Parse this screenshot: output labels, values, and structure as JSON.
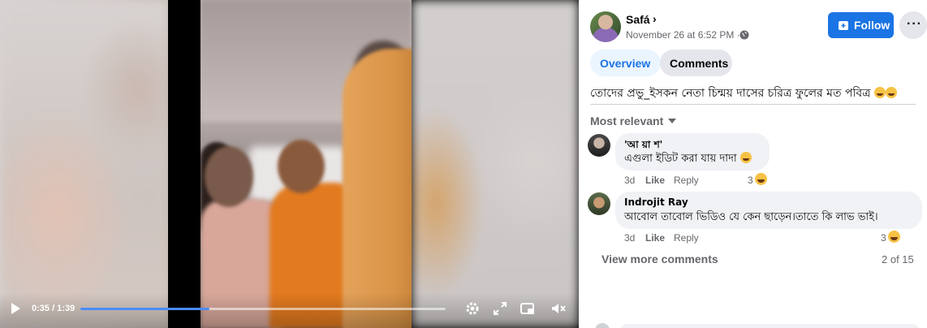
{
  "video": {
    "time_display": "0:35 / 1:39",
    "progress_fraction": 0.354
  },
  "post": {
    "author": "Safá",
    "author_chevron": "›",
    "timestamp": "November 26 at 6:52 PM ·",
    "follow_label": "Follow",
    "more_label": "···",
    "caption": "তোদের প্রভু_ইসকন নেতা চিন্ময় দাসের চরিত্র ফুলের মত পবিত্র"
  },
  "tabs": [
    {
      "label": "Overview",
      "active": true
    },
    {
      "label": "Comments",
      "active": false
    }
  ],
  "comments_header": {
    "sort_label": "Most relevant"
  },
  "comments": [
    {
      "name": "'আ য়া শ'",
      "text": "এগুলা ইডিট করা যায় দাদা",
      "age": "3d",
      "like": "Like",
      "reply": "Reply",
      "reactions": "3"
    },
    {
      "name": "Indrojit Ray",
      "text": "আবোল তাবোল ভিডিও যে কেন ছাড়েন।তাতে কি লাভ ভাই।",
      "age": "3d",
      "like": "Like",
      "reply": "Reply",
      "reactions": "3"
    }
  ],
  "footer": {
    "view_more": "View more comments",
    "page_count": "2 of 15"
  },
  "colors": {
    "accent": "#1b74e4",
    "progress": "#4a8cf7",
    "secondary_text": "#65676b",
    "bubble": "#f0f2f5"
  },
  "icons": [
    "play-icon",
    "settings-icon",
    "fullscreen-icon",
    "picture-in-picture-icon",
    "volume-muted-icon",
    "globe-icon",
    "follow-icon",
    "more-icon",
    "caret-down-icon"
  ]
}
